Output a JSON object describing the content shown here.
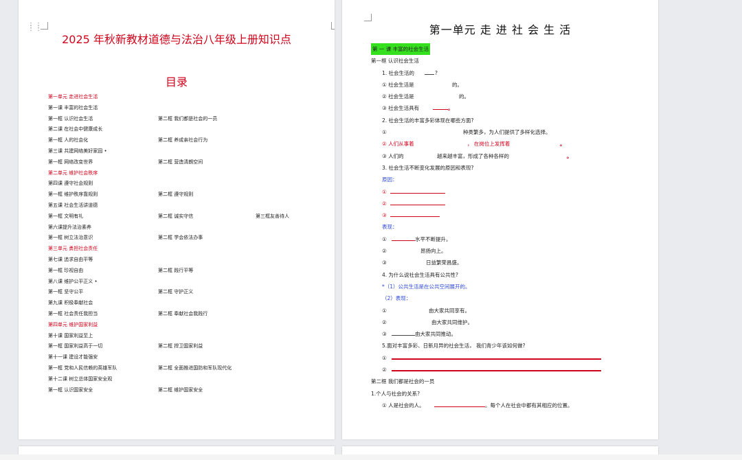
{
  "left_page": {
    "title": "2025 年秋新教材道德与法治八年级上册知识点",
    "toc_title": "目录",
    "toc": [
      {
        "a": "第一单元  走进社会生活",
        "b": "",
        "c": "",
        "red": true
      },
      {
        "a": "第一课    丰富的社会生活",
        "b": "",
        "c": "",
        "red": false
      },
      {
        "a": "第一框    认识社会生活",
        "b": "第二框   我们都是社会的一员",
        "c": "",
        "red": false
      },
      {
        "a": "第二课    在社会中健康成长",
        "b": "",
        "c": "",
        "red": false
      },
      {
        "a": "第一框    人的社会化",
        "b": "第二框   养成亲社会行为",
        "c": "",
        "red": false
      },
      {
        "a": "第三课    共建网络美好家园 •",
        "b": "",
        "c": "",
        "red": false
      },
      {
        "a": "第一框    网络改变世界",
        "b": "第二框   营造清朗空间",
        "c": "",
        "red": false
      },
      {
        "a": "第二单元  维护社会秩序",
        "b": "",
        "c": "",
        "red": true
      },
      {
        "a": "第四课    遵守社会规则",
        "b": "",
        "c": "",
        "red": false
      },
      {
        "a": "第一框    维护秩序靠规则",
        "b": "第二框   遵守规则",
        "c": "",
        "red": false
      },
      {
        "a": "第五课    社会生活讲道德",
        "b": "",
        "c": "",
        "red": false
      },
      {
        "a": "第一框    文明有礼",
        "b": "第二框   诚实守信",
        "c": "第三框友善待人",
        "red": false
      },
      {
        "a": "第六课提升法治素养",
        "b": "",
        "c": "",
        "red": false
      },
      {
        "a": "第一框    树立法治意识",
        "b": "第二框   学会依法办事",
        "c": "",
        "red": false
      },
      {
        "a": "第三单元  勇担社会责任",
        "b": "",
        "c": "",
        "red": true
      },
      {
        "a": "第七课      追求自由平等",
        "b": "",
        "c": "",
        "red": false
      },
      {
        "a": "第一框      珍视自由",
        "b": "第二框    践行平等",
        "c": "",
        "red": false
      },
      {
        "a": "第八课      维护公平正义 •",
        "b": "",
        "c": "",
        "red": false
      },
      {
        "a": "第一框      坚守公平",
        "b": "第二框    守护正义",
        "c": "",
        "red": false
      },
      {
        "a": "第九课      积极奉献社会",
        "b": "",
        "c": "",
        "red": false
      },
      {
        "a": "第一框      社会责任我担当",
        "b": "第二框    奉献社会我践行",
        "c": "",
        "red": false
      },
      {
        "a": "第四单元  维护国家利益",
        "b": "",
        "c": "",
        "red": true
      },
      {
        "a": "第十课    国家利益至上",
        "b": "",
        "c": "",
        "red": false
      },
      {
        "a": "第一框      国家利益高于一切",
        "b": "第二框    捍卫国家利益",
        "c": "",
        "red": false
      },
      {
        "a": "第十一课    建设才能强安",
        "b": "",
        "c": "",
        "red": false
      },
      {
        "a": "第一框      党和人民信赖的英雄军队",
        "b": "第二框    全面推进国防和军队现代化",
        "c": "",
        "red": false
      },
      {
        "a": "第十二课    树立总体国家安全观",
        "b": "",
        "c": "",
        "red": false
      },
      {
        "a": "第一框      认识国家安全",
        "b": "第二框    维护国家安全",
        "c": "",
        "red": false
      }
    ]
  },
  "right_page": {
    "unit_title": "第一单元  走 进 社 会 生 活",
    "lesson_title": "第 一 课  丰富的社会生活",
    "s1": "第一框   认识社会生活",
    "q1": "1.   社会生活的",
    "q1_end": "?",
    "q1_1a": "①   社会生活是",
    "q1_1b": "的。",
    "q1_2a": "②   社会生活是",
    "q1_2b": "的。",
    "q1_3a": "③   社会生活具有",
    "q1_3b": "。",
    "q2": "2.   社会生活的丰富多彩体现在哪些方面?",
    "q2_1a": "①",
    "q2_1b": "种类繁多，为人们提供了多样化选择。",
    "q2_2a": "②   人们从事着",
    "q2_2b": "，   在岗位上发挥着",
    "q2_2c": "。",
    "q2_3a": "③   人们的",
    "q2_3b": "越来越丰富，形成了各种各样的",
    "q2_3c": "。",
    "q3": "3.   社会生活不断变化发展的原因和表现?",
    "reason_label": "原因：",
    "r1": "①",
    "r2": "②",
    "r3": "③",
    "show_label": "表现：",
    "p1a": "①",
    "p1b": "水平不断提升。",
    "p2a": "②",
    "p2b": "昂扬向上。",
    "p3a": "③",
    "p3b": "日益繁荣昌盛。",
    "q4": "4.   为什么说社会生活具有公共性?",
    "q4_1": "*（1）公共生活是在公共空间展开的。",
    "q4_2": "（2）表现：",
    "q4_2_1a": "①",
    "q4_2_1b": "由大家共同享有。",
    "q4_2_2a": "②",
    "q4_2_2b": "由大家共同维护。",
    "q4_2_3a": "③",
    "q4_2_3b": "由大家共同推动。",
    "q5": "5.面对丰富多彩、日新月异的社会生活，   我们青少年该如何做?",
    "q5_1": "①",
    "q5_2": "②",
    "s2": "第二框   我们都是社会的一员",
    "s2_q1": "1.个人与社会的关系?",
    "s2_q1_1a": "①   人是社会的人。",
    "s2_q1_1b": "。每个人在社会中都有其相应的位置。"
  }
}
